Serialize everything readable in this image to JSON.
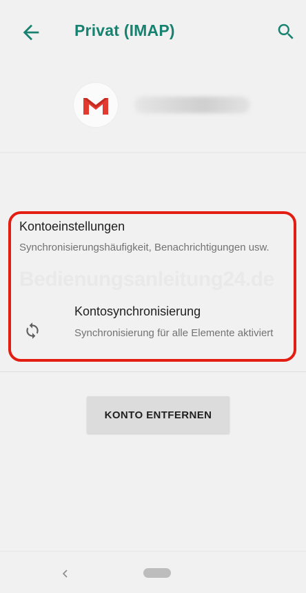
{
  "appbar": {
    "title": "Privat (IMAP)",
    "back_icon": "arrow-left-icon",
    "search_icon": "search-icon",
    "accent_color": "#16826f"
  },
  "account": {
    "avatar_icon": "gmail-icon"
  },
  "settings": {
    "account_settings": {
      "title": "Kontoeinstellungen",
      "subtitle": "Synchronisierungshäufigkeit, Benachrichtigungen usw."
    },
    "watermark": "Bedienungsanleitung24.de",
    "account_sync": {
      "icon": "sync-icon",
      "title": "Kontosynchronisierung",
      "subtitle": "Synchronisierung für alle Elemente aktiviert"
    },
    "highlight_color": "#e41d12"
  },
  "actions": {
    "remove_account_label": "KONTO ENTFERNEN"
  },
  "navbar": {
    "back_icon": "nav-back-icon",
    "home_icon": "nav-home-pill-icon"
  }
}
